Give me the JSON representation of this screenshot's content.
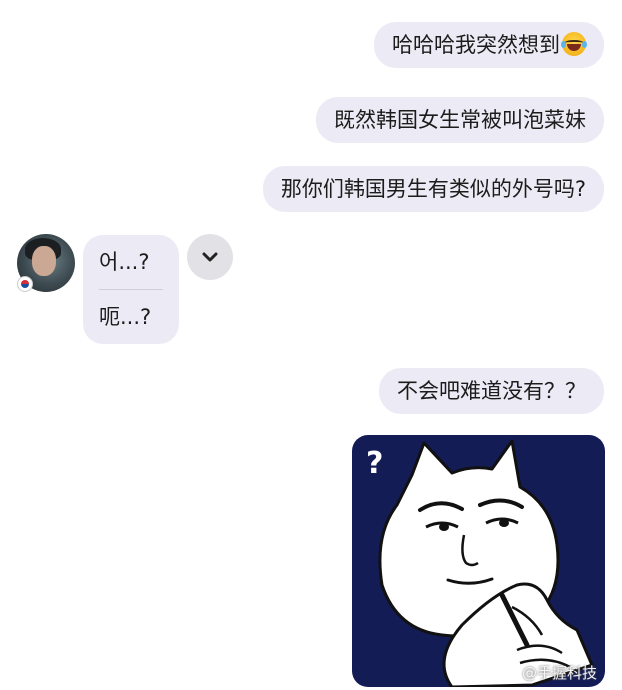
{
  "messages": {
    "out1": "哈哈哈我突然想到",
    "out1_emoji": "laughing-tears-emoji",
    "out2": "既然韩国女生常被叫泡菜妹",
    "out3": "那你们韩国男生有类似的外号吗?",
    "in1": "어...?",
    "in2": "呃...?",
    "out4": "不会吧难道没有？？"
  },
  "contact": {
    "avatar": "contact-avatar",
    "flag": "south-korea-flag"
  },
  "sticker": {
    "description_icon": "cat-thinking-sticker",
    "question_mark": "?"
  },
  "watermark": {
    "text": "@手握科技",
    "icon": "weibo-icon"
  },
  "colors": {
    "bubble": "#ecebf5",
    "sticker_bg": "#131c55",
    "chevron_bg": "#e2e1e6"
  }
}
